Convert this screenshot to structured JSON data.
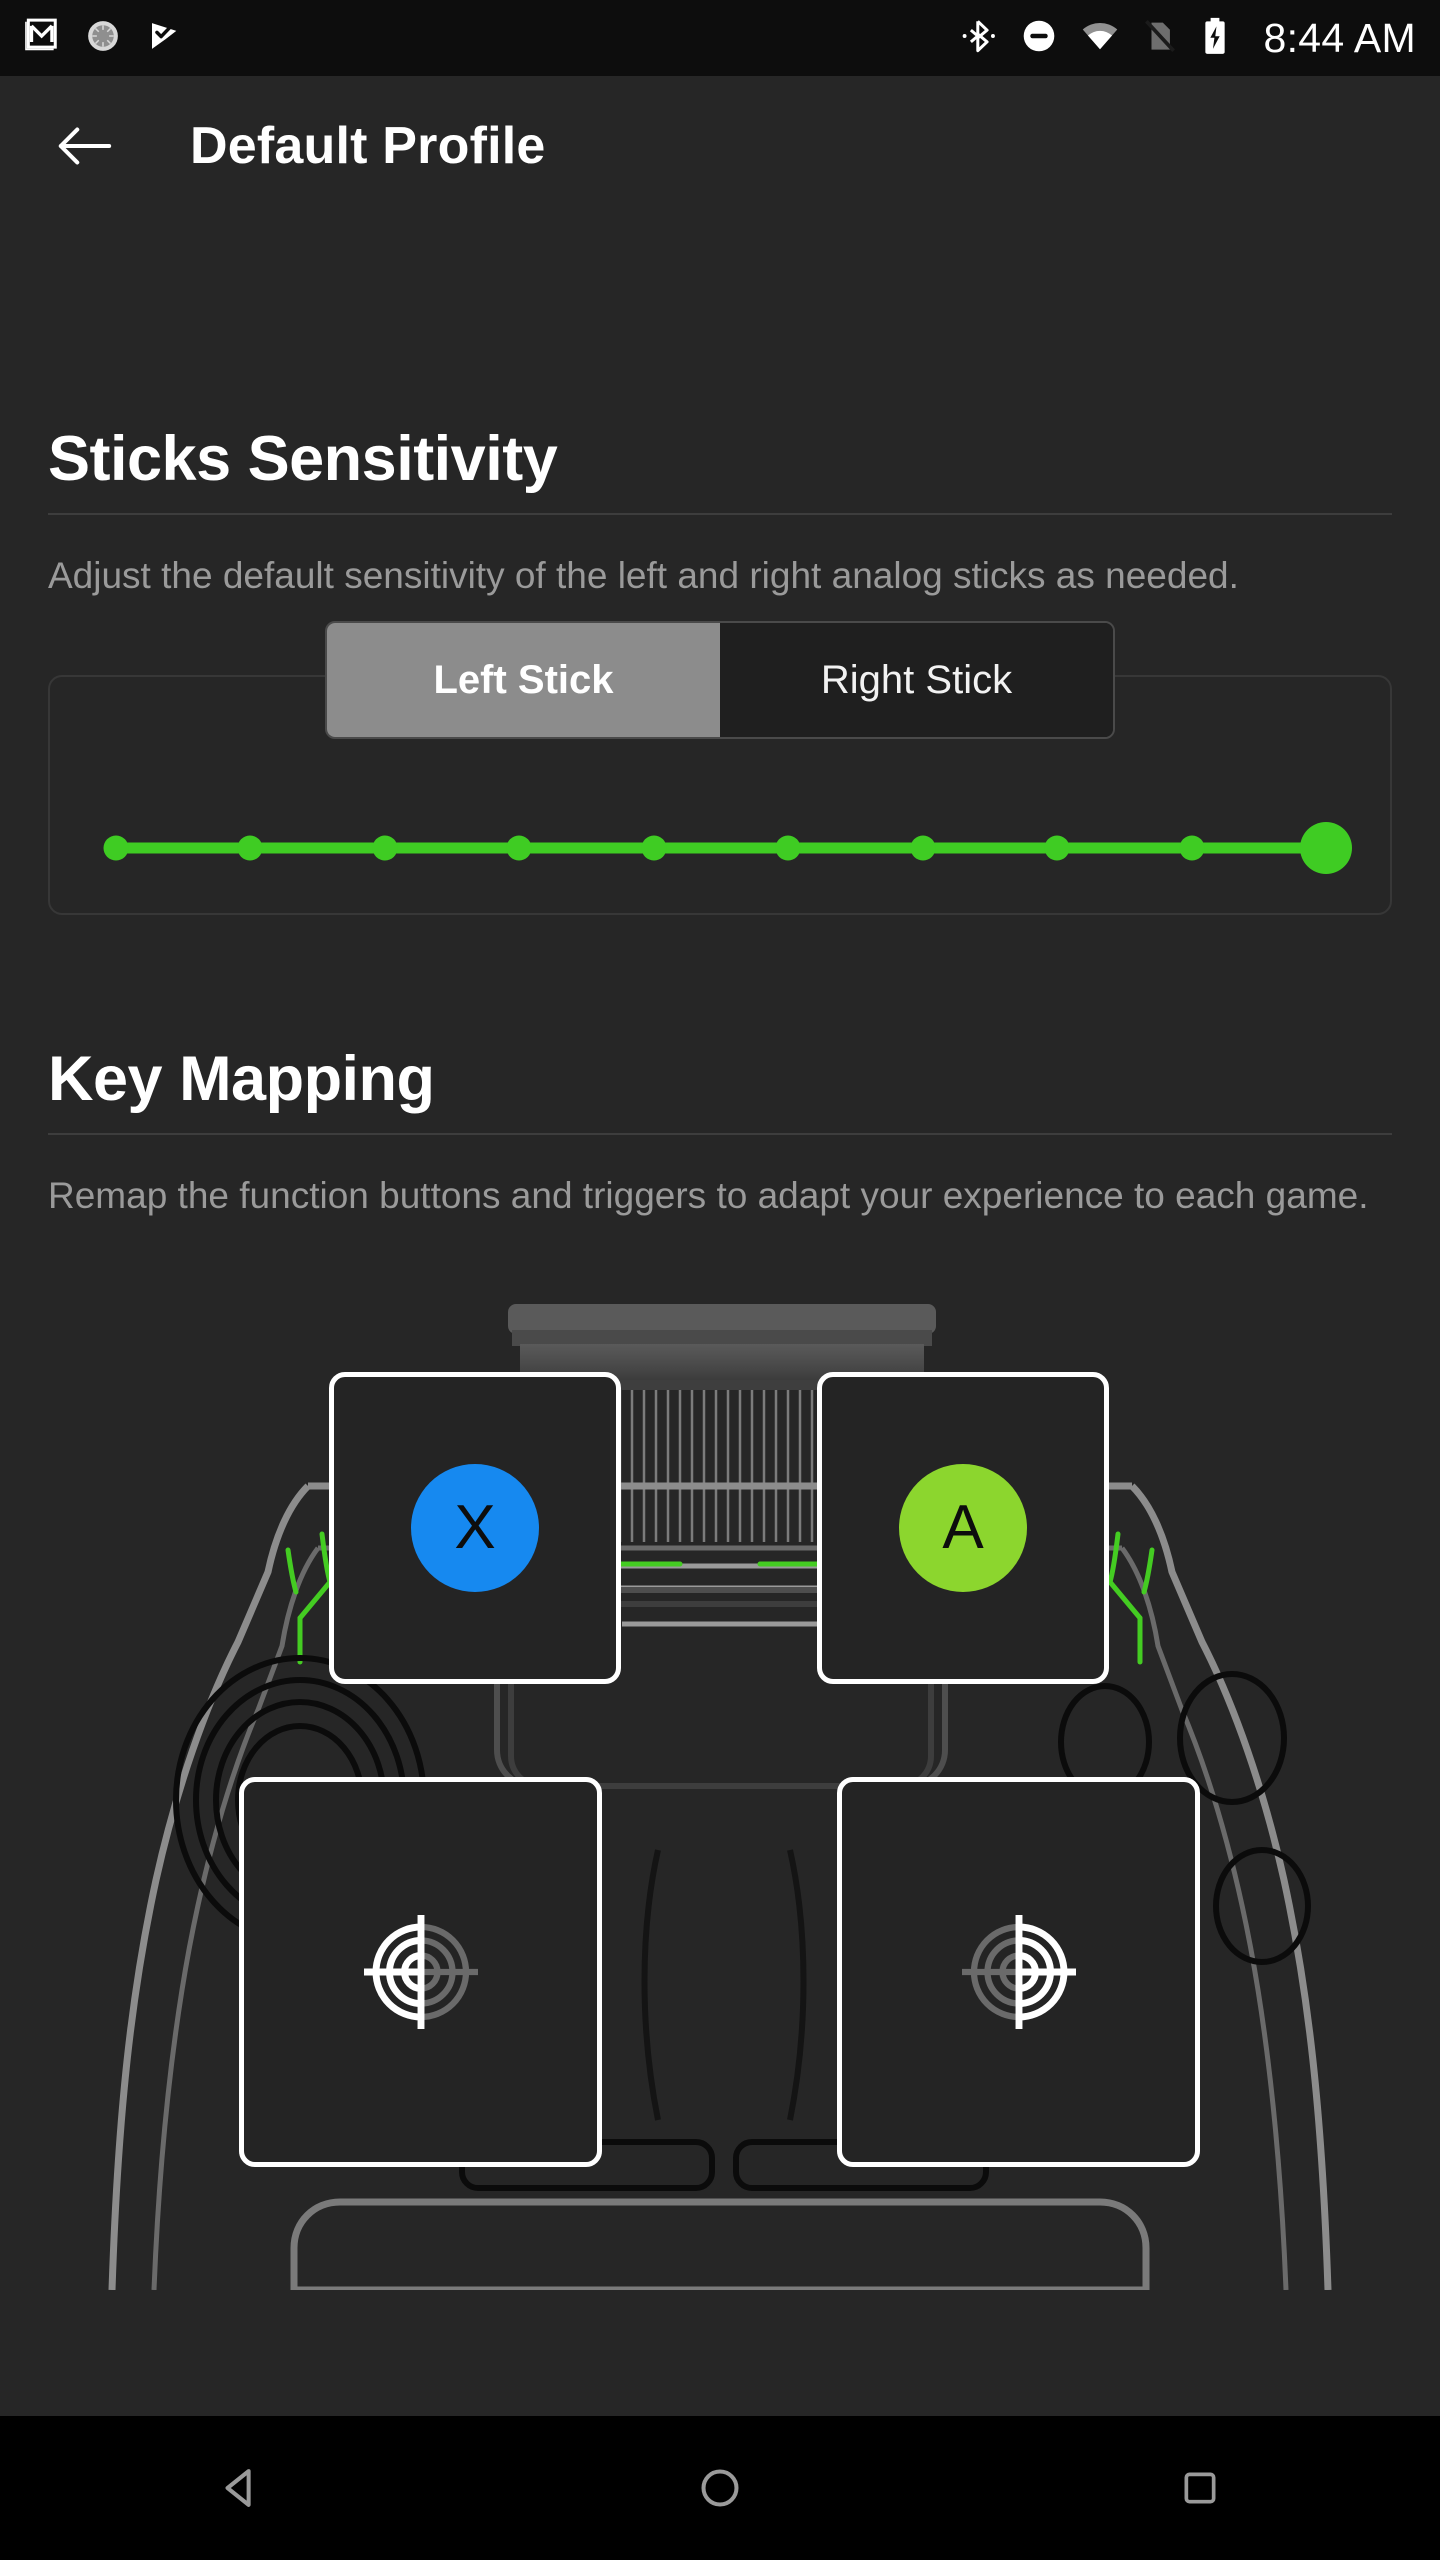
{
  "statusbar": {
    "time": "8:44 AM",
    "left_icons": [
      "gmail-icon",
      "sync-progress-icon",
      "task-check-icon"
    ],
    "right_icons": [
      "bluetooth-icon",
      "do-not-disturb-icon",
      "wifi-icon",
      "no-sim-icon",
      "battery-charging-icon"
    ]
  },
  "appbar": {
    "back_icon": "arrow-left-icon",
    "title": "Default Profile"
  },
  "sticks": {
    "title": "Sticks Sensitivity",
    "description": "Adjust the default sensitivity of the left and right analog sticks as needed.",
    "tabs": [
      {
        "label": "Left Stick",
        "selected": true
      },
      {
        "label": "Right Stick",
        "selected": false
      }
    ],
    "slider": {
      "steps": 10,
      "value": 10,
      "min": 1,
      "max": 10,
      "accent_color": "#3fcc23"
    }
  },
  "keymapping": {
    "title": "Key Mapping",
    "description": "Remap the function buttons and triggers to adapt your experience to each game.",
    "cards": [
      {
        "id": "x-button",
        "icon": "xbox-x-button-icon",
        "label": "X",
        "color": "#1689f0"
      },
      {
        "id": "a-button",
        "icon": "xbox-a-button-icon",
        "label": "A",
        "color": "#8cd62e"
      },
      {
        "id": "left-trigger",
        "icon": "left-crosshair-icon",
        "label": "",
        "color": "#ffffff"
      },
      {
        "id": "right-trigger",
        "icon": "right-crosshair-icon",
        "label": "",
        "color": "#ffffff"
      }
    ]
  },
  "navbar": {
    "buttons": [
      {
        "name": "back-nav-button",
        "icon": "triangle-left-icon"
      },
      {
        "name": "home-nav-button",
        "icon": "circle-icon"
      },
      {
        "name": "recents-nav-button",
        "icon": "square-icon"
      }
    ]
  },
  "theme": {
    "background": "#262626",
    "statusbar_bg": "#0d0d0d",
    "navbar_bg": "#000000",
    "accent_green": "#3fcc23",
    "text_primary": "#ffffff",
    "text_secondary": "#9a9a9a",
    "divider": "#3d3d3d"
  }
}
